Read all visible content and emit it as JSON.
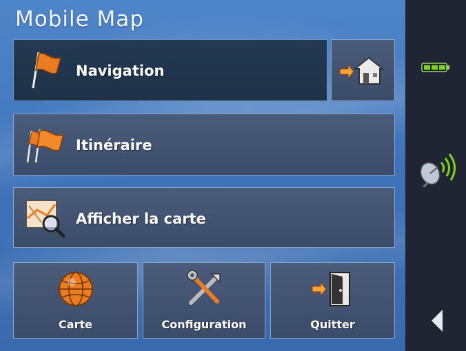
{
  "app": {
    "title": "Mobile Map"
  },
  "menu": {
    "navigation": "Navigation",
    "itineraire": "Itinéraire",
    "afficher_carte": "Afficher la carte"
  },
  "bottom": {
    "carte": "Carte",
    "configuration": "Configuration",
    "quitter": "Quitter"
  },
  "icons": {
    "navigation": "flag-icon",
    "home": "home-arrow-icon",
    "itineraire": "multi-flag-icon",
    "carte": "map-magnifier-icon",
    "globe": "globe-icon",
    "config": "tools-icon",
    "quit": "exit-door-icon",
    "battery": "battery-icon",
    "gps": "satellite-signal-icon",
    "back": "back-arrow-icon"
  },
  "colors": {
    "accent": "#e97b20",
    "battery": "#7ed321",
    "signal": "#7ed321"
  }
}
